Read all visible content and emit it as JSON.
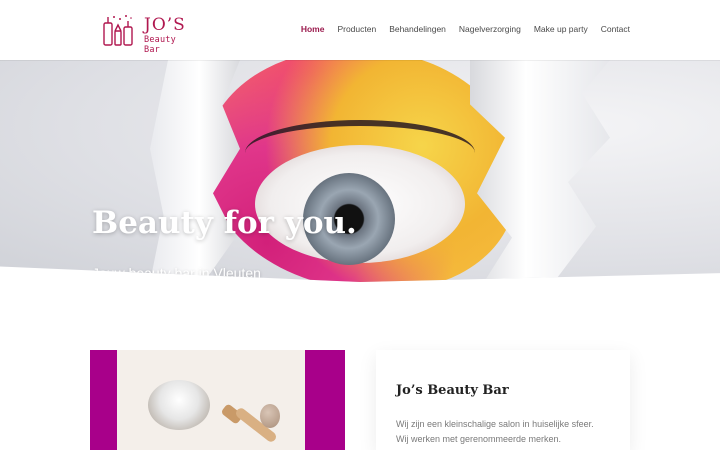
{
  "brand": {
    "name": "JO’S",
    "tagline": "Beauty Bar",
    "color": "#b0174f"
  },
  "nav": {
    "items": [
      "Home",
      "Producten",
      "Behandelingen",
      "Nagelverzorging",
      "Make up party",
      "Contact"
    ],
    "active": "Home",
    "active_color": "#9b1b4e"
  },
  "hero": {
    "title": "Beauty for you.",
    "subtitle": "Jouw beauty bar in Vleuten"
  },
  "about": {
    "title": "Jo’s Beauty Bar",
    "lines": [
      "Wij zijn een kleinschalige salon in huiselijke sfeer.",
      "Wij werken met gerenommeerde merken."
    ],
    "accent_color": "#a8008a"
  },
  "icons": {
    "logo": "cosmetics-logo-icon"
  }
}
